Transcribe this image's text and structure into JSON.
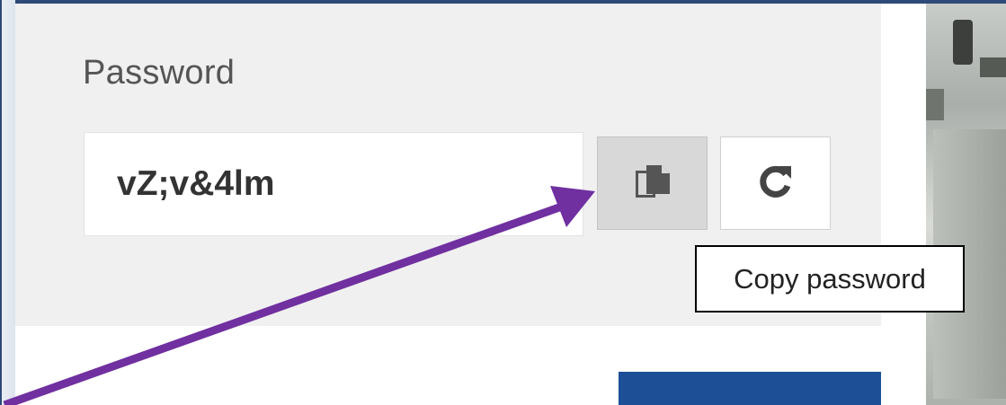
{
  "password_section": {
    "label": "Password",
    "value": "vZ;v&4lm",
    "copy_button": {
      "icon": "copy-icon"
    },
    "refresh_button": {
      "icon": "refresh-icon"
    },
    "tooltip": "Copy password"
  },
  "annotation": {
    "arrow_color": "#7030a0",
    "points_to": "copy-button"
  },
  "colors": {
    "panel_background": "#f0f0f0",
    "primary_button": "#1d4f97",
    "copy_button_active": "#d8d8d8",
    "window_frame": "#2e4a78"
  }
}
